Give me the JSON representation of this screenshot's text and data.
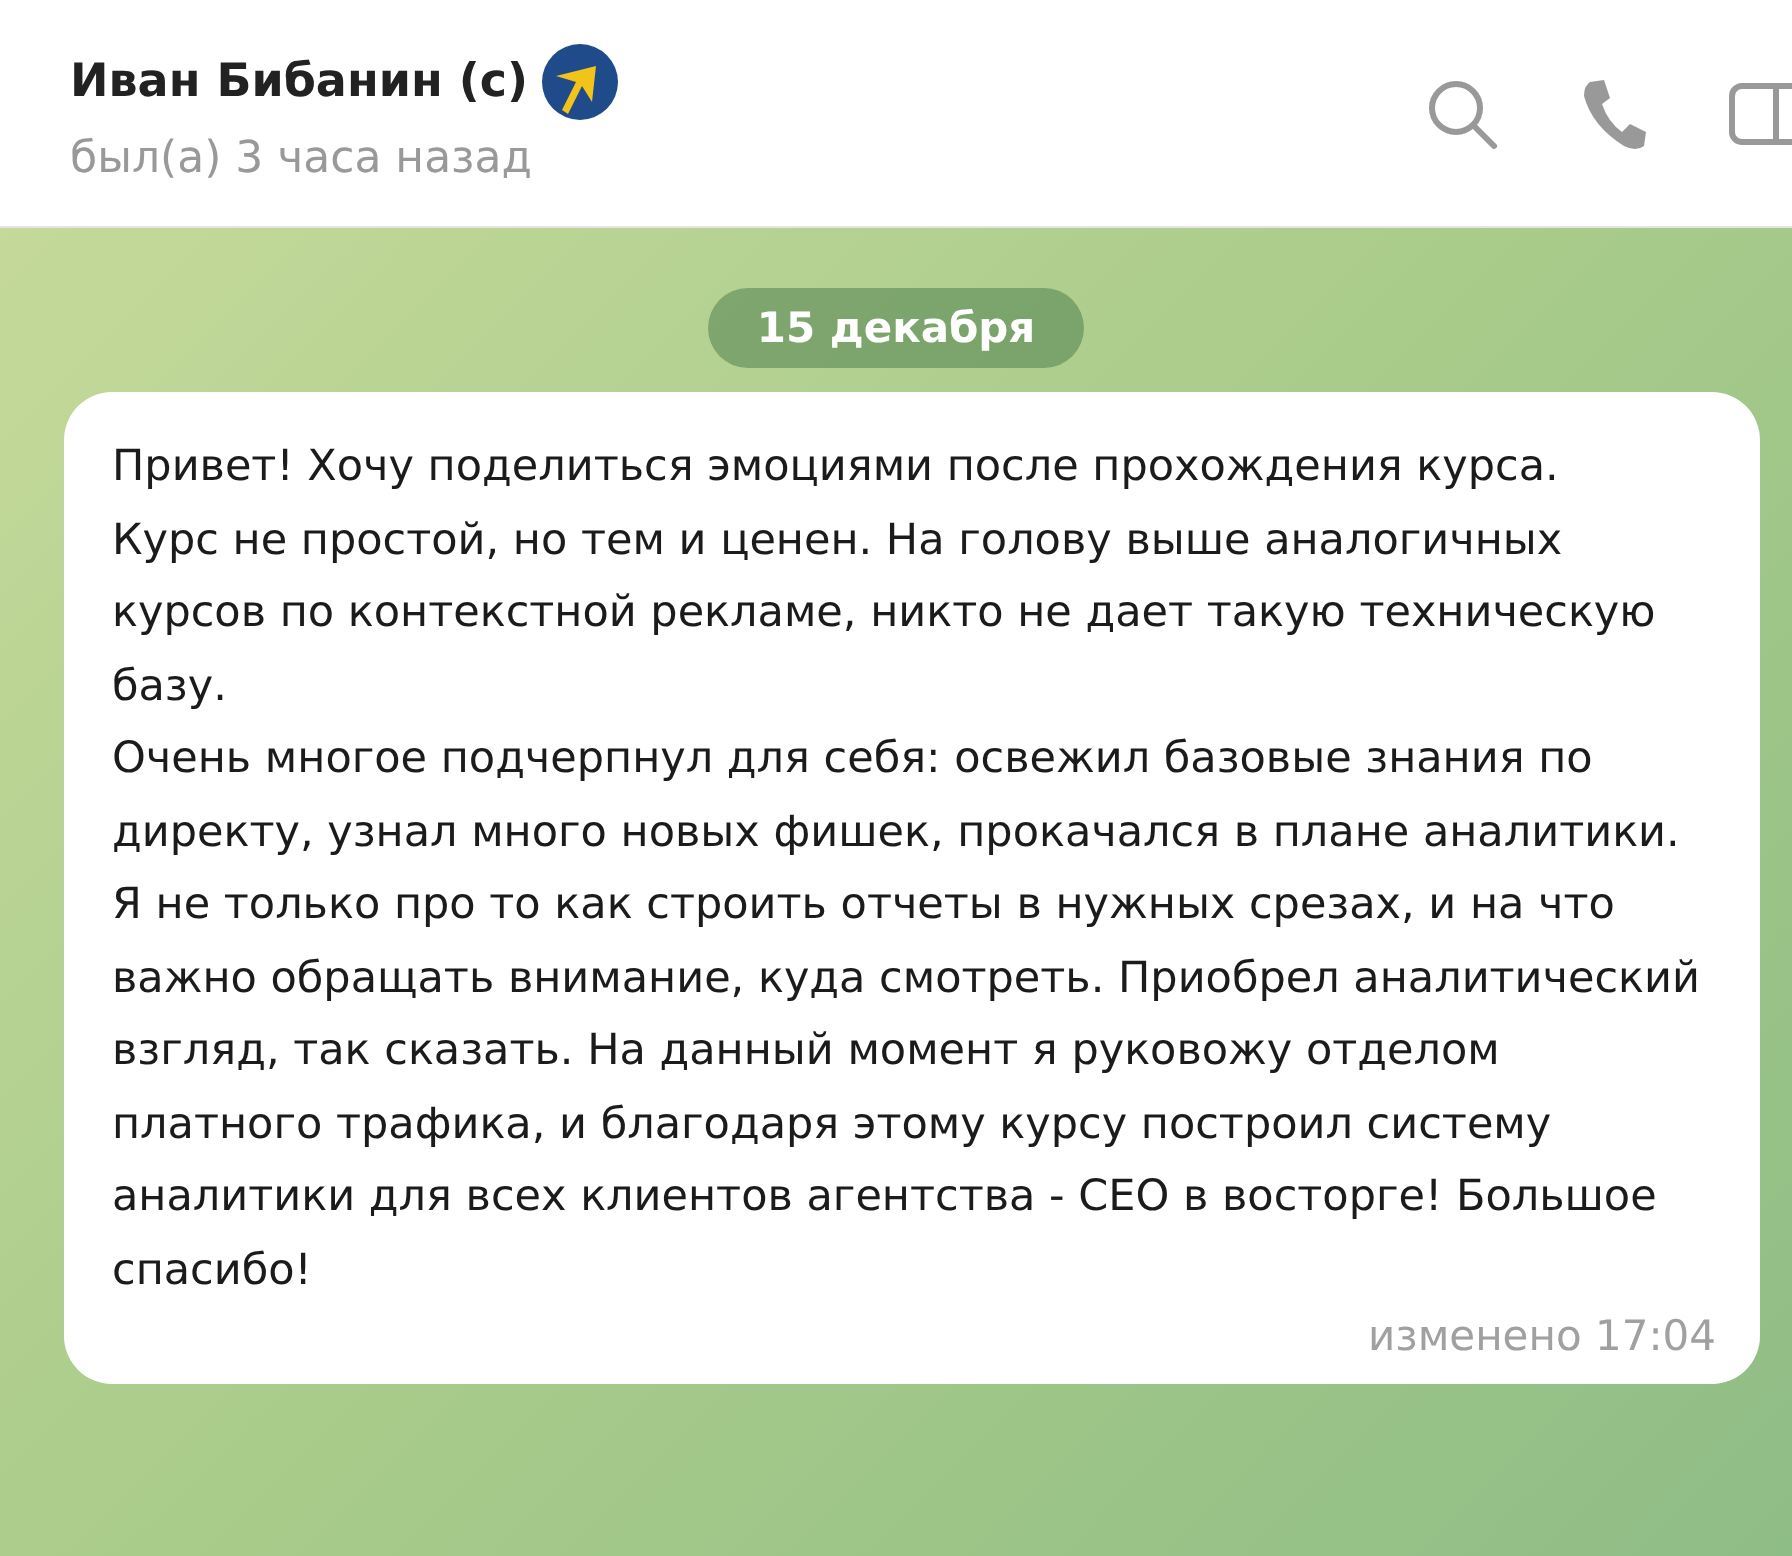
{
  "header": {
    "name": "Иван Бибанин (с)",
    "status": "был(а) 3 часа назад"
  },
  "date_label": "15 декабря",
  "message": {
    "paragraphs": [
      "Привет! Хочу поделиться эмоциями после прохождения курса.",
      "Курс не простой, но тем и ценен. На голову выше аналогичных курсов по контекстной рекламе, никто не дает такую техническую базу.",
      "Очень многое подчерпнул для себя: освежил базовые знания по директу, узнал много новых фишек, прокачался в плане аналитики. Я не только про то как строить отчеты в нужных срезах, и на что важно обращать внимание, куда смотреть. Приобрел аналитический взгляд, так сказать. На данный момент я руковожу отделом платного трафика, и благодаря этому курсу построил систему аналитики для всех клиентов агентства - СЕО в восторге! Большое спасибо!"
    ],
    "meta": "изменено 17:04"
  }
}
